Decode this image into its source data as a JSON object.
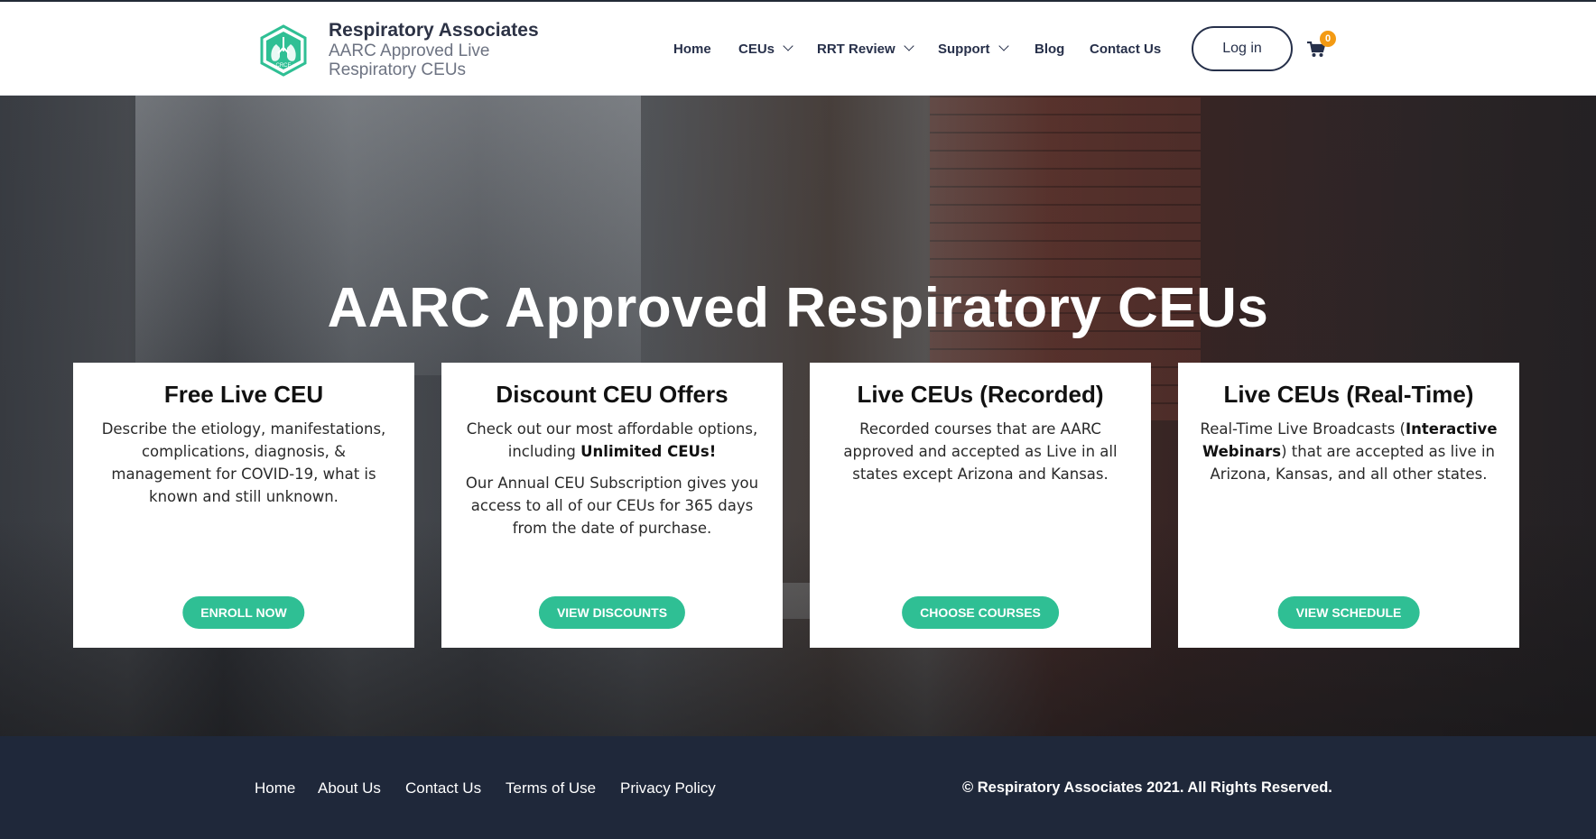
{
  "brand": {
    "name": "Respiratory Associates",
    "tagline": "AARC Approved Live Respiratory CEUs",
    "logo_text": "CRCE"
  },
  "nav": {
    "items": [
      {
        "label": "Home",
        "dropdown": false
      },
      {
        "label": "CEUs",
        "dropdown": true
      },
      {
        "label": "RRT Review",
        "dropdown": true
      },
      {
        "label": "Support",
        "dropdown": true
      },
      {
        "label": "Blog",
        "dropdown": false
      },
      {
        "label": "Contact Us",
        "dropdown": false
      }
    ],
    "login_label": "Log in",
    "cart_count": "0"
  },
  "hero": {
    "title": "AARC Approved Respiratory CEUs"
  },
  "cards": [
    {
      "title": "Free Live CEU",
      "body1": "Describe the etiology, manifestations, complications, diagnosis, & management for COVID-19, what is known and still unknown.",
      "button": "ENROLL NOW"
    },
    {
      "title": "Discount CEU Offers",
      "body1_pre": "Check out our most affordable options, including ",
      "body1_bold": "Unlimited CEUs!",
      "body2": "Our Annual CEU Subscription gives you access to all of our CEUs for 365 days from the date of purchase.",
      "button": "VIEW DISCOUNTS"
    },
    {
      "title": "Live CEUs (Recorded)",
      "body1": "Recorded courses that are AARC approved and accepted as Live in all states except Arizona and Kansas.",
      "button": "CHOOSE COURSES"
    },
    {
      "title": "Live CEUs (Real-Time)",
      "body1_pre": "Real-Time Live Broadcasts (",
      "body1_bold": "Interactive Webinars",
      "body1_post": ") that are accepted as live in Arizona, Kansas, and all other states.",
      "button": "VIEW SCHEDULE"
    }
  ],
  "footer": {
    "links": [
      "Home",
      "About Us",
      "Contact Us",
      "Terms of Use",
      "Privacy Policy"
    ],
    "copyright": "© Respiratory Associates 2021. All Rights Reserved."
  },
  "colors": {
    "accent": "#2fbf94",
    "navy": "#1f283a",
    "badge": "#f39a13"
  }
}
